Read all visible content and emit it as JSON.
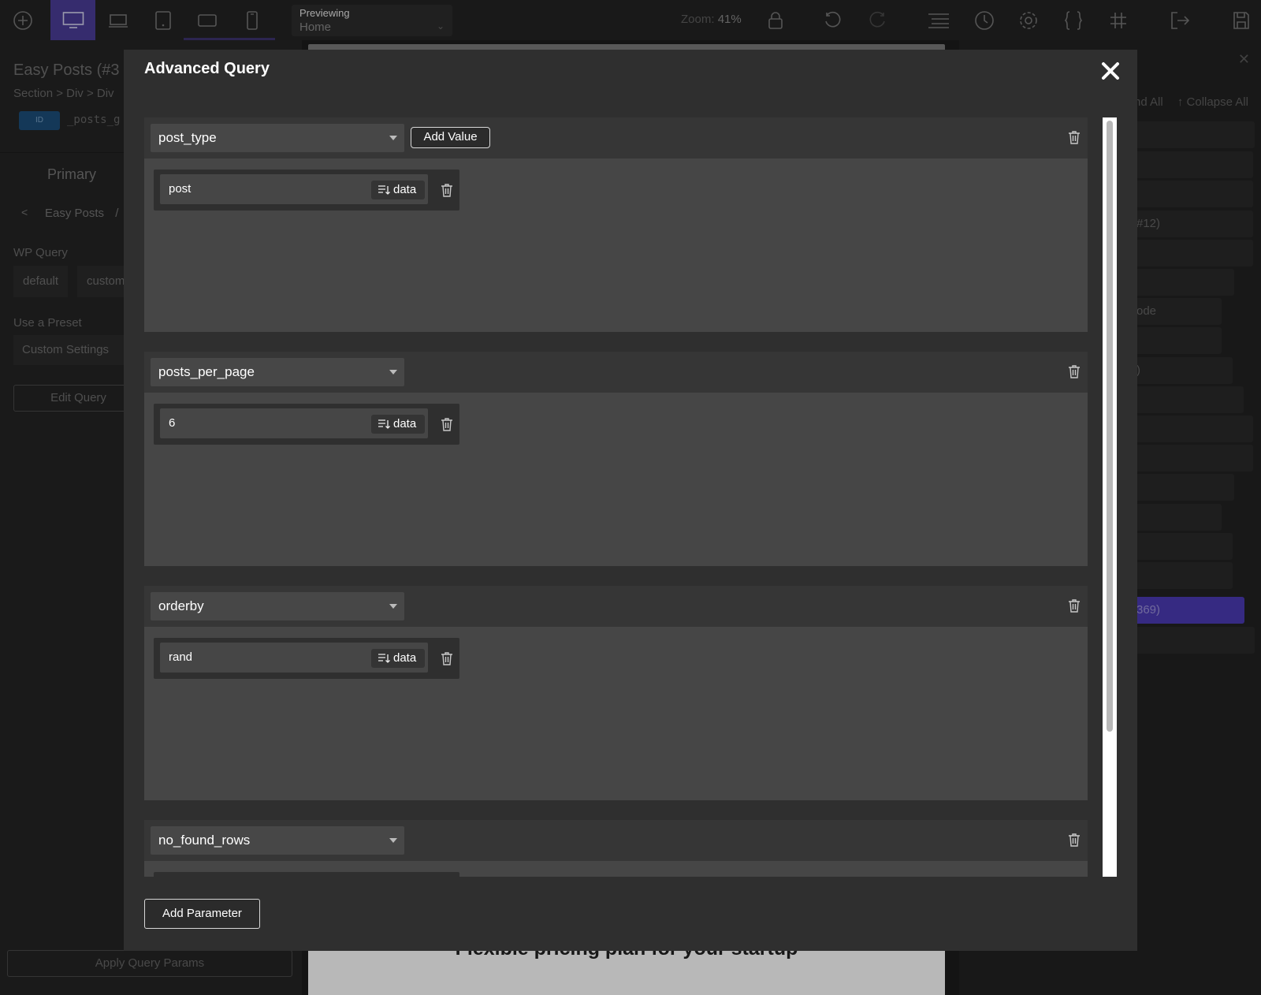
{
  "toolbar": {
    "preview_label": "Previewing",
    "preview_value": "Home",
    "zoom_label": "Zoom:",
    "zoom_value": "41%"
  },
  "left_panel": {
    "title": "Easy Posts (#3",
    "breadcrumb": "Section > Div > Div",
    "id_badge": "ID",
    "id_value": "_posts_g",
    "tab_primary": "Primary",
    "crumb_back": "<",
    "crumb_current": "Easy Posts",
    "crumb_sep": "/",
    "wp_query_label": "WP Query",
    "wp_query_options": [
      "default",
      "custom"
    ],
    "preset_label": "Use a Preset",
    "preset_value": "Custom Settings",
    "edit_query": "Edit Query",
    "apply_query": "Apply Query Params"
  },
  "canvas": {
    "heading": "Flexible pricing plan for your startup"
  },
  "right_panel": {
    "expand_all": "nd All",
    "collapse_all": "↑ Collapse All",
    "rows": [
      "",
      "",
      "",
      "#12)",
      "",
      "",
      "ode",
      "",
      ")",
      "",
      "",
      "",
      "",
      "",
      "",
      "",
      "369)",
      ""
    ]
  },
  "modal": {
    "title": "Advanced Query",
    "add_value_label": "Add Value",
    "data_label": "data",
    "add_parameter_label": "Add Parameter",
    "params": [
      {
        "key": "post_type",
        "value": "post"
      },
      {
        "key": "posts_per_page",
        "value": "6"
      },
      {
        "key": "orderby",
        "value": "rand"
      },
      {
        "key": "no_found_rows",
        "value": ""
      }
    ]
  }
}
